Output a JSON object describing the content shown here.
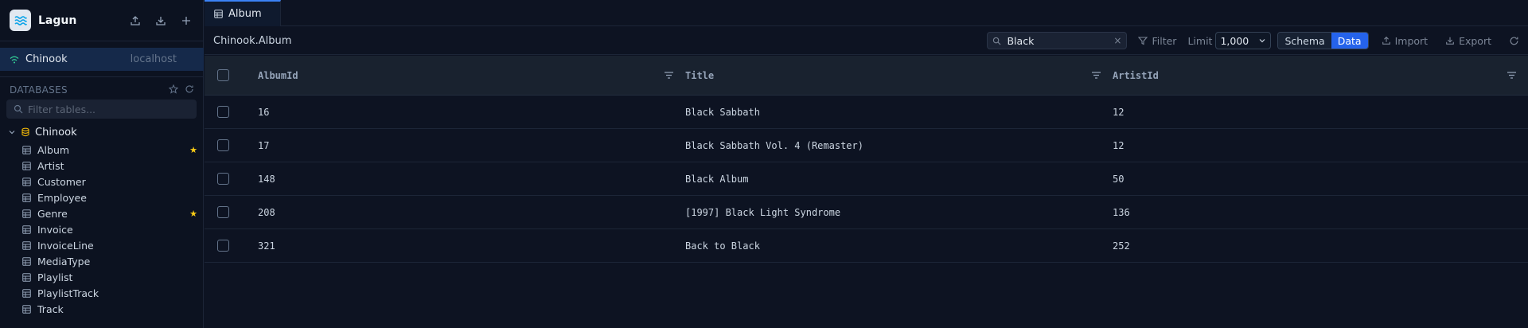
{
  "app": {
    "title": "Lagun"
  },
  "connection": {
    "name": "Chinook",
    "host": "localhost"
  },
  "sidebar": {
    "section_label": "DATABASES",
    "filter_placeholder": "Filter tables...",
    "database": {
      "name": "Chinook"
    },
    "tables": [
      {
        "name": "Album",
        "starred": true
      },
      {
        "name": "Artist",
        "starred": false
      },
      {
        "name": "Customer",
        "starred": false
      },
      {
        "name": "Employee",
        "starred": false
      },
      {
        "name": "Genre",
        "starred": true
      },
      {
        "name": "Invoice",
        "starred": false
      },
      {
        "name": "InvoiceLine",
        "starred": false
      },
      {
        "name": "MediaType",
        "starred": false
      },
      {
        "name": "Playlist",
        "starred": false
      },
      {
        "name": "PlaylistTrack",
        "starred": false
      },
      {
        "name": "Track",
        "starred": false
      }
    ]
  },
  "tabs": [
    {
      "label": "Album",
      "active": true
    }
  ],
  "toolbar": {
    "breadcrumb": "Chinook.Album",
    "search_value": "Black",
    "filter_label": "Filter",
    "limit_label": "Limit",
    "limit_value": "1,000",
    "schema_label": "Schema",
    "data_label": "Data",
    "import_label": "Import",
    "export_label": "Export"
  },
  "grid": {
    "columns": [
      "AlbumId",
      "Title",
      "ArtistId"
    ],
    "rows": [
      [
        "16",
        "Black Sabbath",
        "12"
      ],
      [
        "17",
        "Black Sabbath Vol. 4 (Remaster)",
        "12"
      ],
      [
        "148",
        "Black Album",
        "50"
      ],
      [
        "208",
        "[1997] Black Light Syndrome",
        "136"
      ],
      [
        "321",
        "Back to Black",
        "252"
      ]
    ]
  },
  "colors": {
    "accent": "#2563eb",
    "star": "#facc15",
    "db_icon": "#eab308",
    "conn_icon": "#34d399",
    "background": "#0d1322"
  }
}
